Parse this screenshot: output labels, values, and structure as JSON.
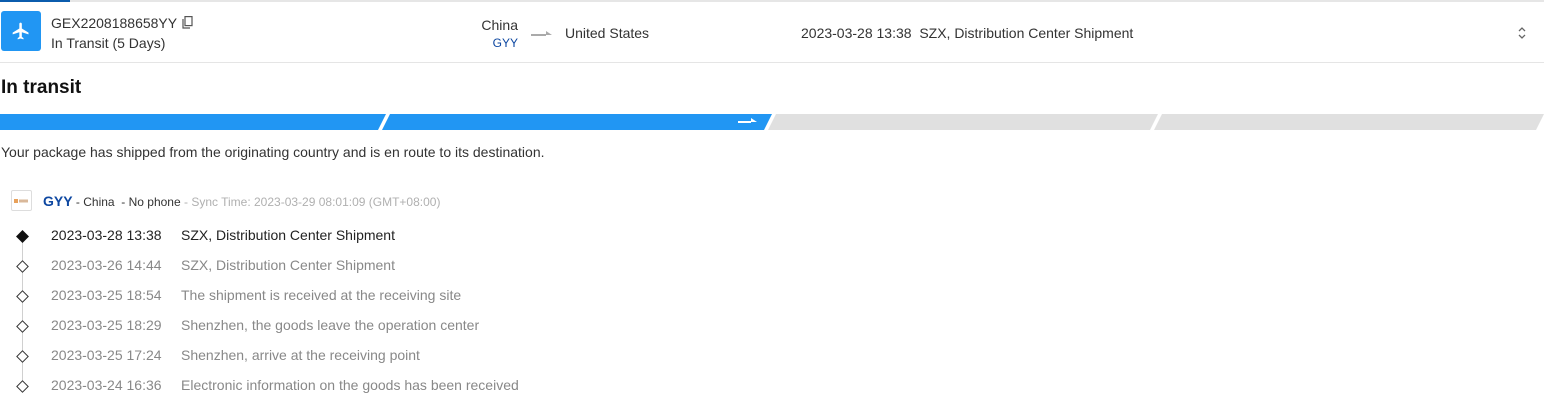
{
  "colors": {
    "accent": "#2196f3",
    "brand_text": "#0d47a1",
    "muted": "#888888",
    "track_empty": "#e0e0e0"
  },
  "shipment": {
    "tracking_number": "GEX2208188658YY",
    "status": "In Transit (5 Days)",
    "origin_country": "China",
    "origin_code": "GYY",
    "destination_country": "United States",
    "latest_event": "2023-03-28 13:38  SZX, Distribution Center Shipment",
    "icons": {
      "carrier": "airplane-icon",
      "copy": "copy-icon",
      "route": "arrow-right-icon",
      "collapse": "collapse-icon"
    }
  },
  "stage": {
    "title": "In transit",
    "description": "Your package has shipped from the originating country and is en route to its destination.",
    "progress": {
      "total_segments": 4,
      "completed_segments": 2
    }
  },
  "provider": {
    "name": "GYY",
    "country_part": " - China ",
    "phone_part": " - No phone ",
    "sync_time": "- Sync Time: 2023-03-29 08:01:09 (GMT+08:00)"
  },
  "events": [
    {
      "time": "2023-03-28 13:38",
      "desc": "SZX, Distribution Center Shipment"
    },
    {
      "time": "2023-03-26 14:44",
      "desc": "SZX, Distribution Center Shipment"
    },
    {
      "time": "2023-03-25 18:54",
      "desc": "The shipment is received at the receiving site"
    },
    {
      "time": "2023-03-25 18:29",
      "desc": "Shenzhen, the goods leave the operation center"
    },
    {
      "time": "2023-03-25 17:24",
      "desc": "Shenzhen, arrive at the receiving point"
    },
    {
      "time": "2023-03-24 16:36",
      "desc": "Electronic information on the goods has been received"
    }
  ]
}
